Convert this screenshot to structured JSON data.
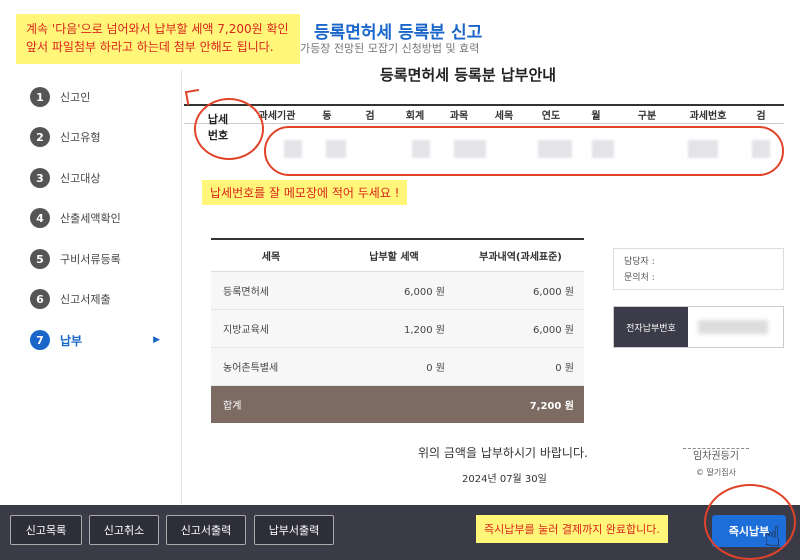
{
  "header": {
    "title": "등록면허세 등록분 신고",
    "subtitle": "가등장 전망된 모잡기 신청방법 및 효력"
  },
  "notes": {
    "top_line1": "계속 '다음'으로 넘어와서 납부할 세액 7,200원 확인",
    "top_line2": "앞서 파일첨부 하라고 하는데 첨부 안해도 됩니다.",
    "tax_number": "납세번호를 잘 메모장에 적어 두세요 !",
    "pay": "즉시납부를 눌러 결제까지 완료합니다."
  },
  "sidebar": {
    "steps": [
      {
        "num": "1",
        "label": "신고인"
      },
      {
        "num": "2",
        "label": "신고유형"
      },
      {
        "num": "3",
        "label": "신고대상"
      },
      {
        "num": "4",
        "label": "산출세액확인"
      },
      {
        "num": "5",
        "label": "구비서류등록"
      },
      {
        "num": "6",
        "label": "신고서제출"
      },
      {
        "num": "7",
        "label": "납부"
      }
    ],
    "active_arrow": "▶"
  },
  "main": {
    "heading": "등록면허세 등록분 납부안내",
    "tax_number_label_1": "납세",
    "tax_number_label_2": "번호",
    "tax_columns": [
      "과세기관",
      "동",
      "검",
      "회계",
      "과목",
      "세목",
      "연도",
      "월",
      "구분",
      "과세번호",
      "검"
    ]
  },
  "amounts": {
    "headers": [
      "세목",
      "납부할 세액",
      "부과내역(과세표준)"
    ],
    "rows": [
      {
        "item": "등록면허세",
        "tax": "6,000 원",
        "base": "6,000 원"
      },
      {
        "item": "지방교육세",
        "tax": "1,200 원",
        "base": "6,000 원"
      },
      {
        "item": "농어촌특별세",
        "tax": "0 원",
        "base": "0 원"
      }
    ],
    "total_label": "합계",
    "total_value": "7,200 원"
  },
  "contact": {
    "manager": "담당자 :",
    "inquiry": "문의처 :"
  },
  "epay": {
    "label": "전자납부번호"
  },
  "request_text": "위의 금액을 납부하시기 바랍니다.",
  "date": "2024년 07월 30일",
  "watermark": {
    "line1": "임차권등기",
    "line2": "© 딸기집사"
  },
  "bottom_bar": {
    "report_list": "신고목록",
    "report_cancel": "신고취소",
    "report_print": "신고서출력",
    "payment_print": "납부서출력",
    "pay_now": "즉시납부"
  },
  "colors": {
    "accent": "#1a66c9",
    "highlight": "#fff67a",
    "annotation": "#e0432a",
    "total_row": "#7c6b63",
    "bottom_bar": "#3b3b47"
  }
}
